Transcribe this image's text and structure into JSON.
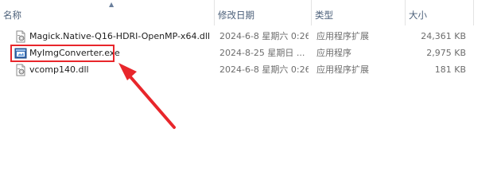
{
  "columns": {
    "name": "名称",
    "date": "修改日期",
    "type": "类型",
    "size": "大小"
  },
  "sort_indicator": "ascending",
  "files": [
    {
      "name": "Magick.Native-Q16-HDRI-OpenMP-x64.dll",
      "date": "2024-6-8 星期六 0:26",
      "type": "应用程序扩展",
      "size": "24,361 KB",
      "icon": "dll-file-icon"
    },
    {
      "name": "MyImgConverter.exe",
      "date": "2024-8-25 星期日 ...",
      "type": "应用程序",
      "size": "2,975 KB",
      "icon": "exe-app-icon"
    },
    {
      "name": "vcomp140.dll",
      "date": "2024-6-8 星期六 0:26",
      "type": "应用程序扩展",
      "size": "181 KB",
      "icon": "dll-file-icon"
    }
  ],
  "colors": {
    "annotation": "#e8262b",
    "header_text": "#4c607a",
    "detail_text": "#6d6d6d"
  }
}
